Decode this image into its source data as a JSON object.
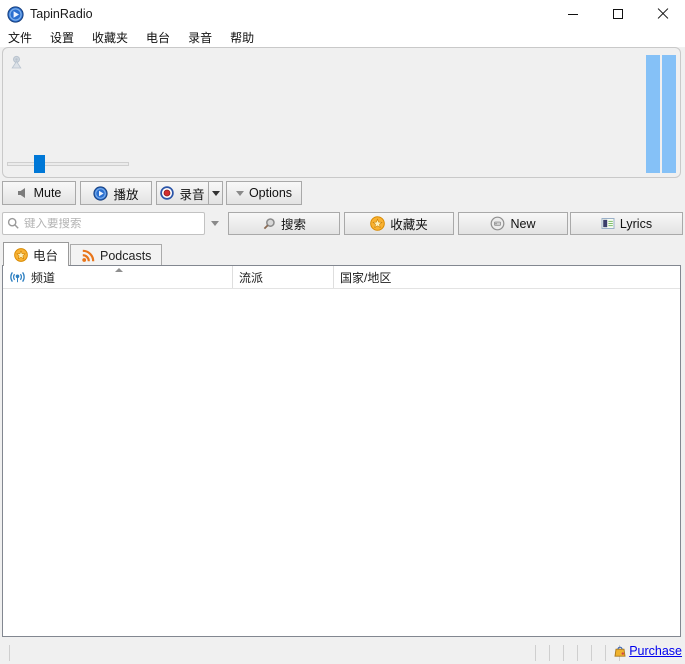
{
  "window": {
    "title": "TapinRadio"
  },
  "menu": {
    "items": [
      "文件",
      "设置",
      "收藏夹",
      "电台",
      "录音",
      "帮助"
    ]
  },
  "player": {
    "volume_percent": 22,
    "meter_count": 2
  },
  "toolbar": {
    "mute_label": "Mute",
    "play_label": "播放",
    "record_label": "录音",
    "options_label": "Options"
  },
  "search": {
    "placeholder": "键入要搜索",
    "search_label": "搜索",
    "favorites_label": "收藏夹",
    "new_label": "New",
    "lyrics_label": "Lyrics"
  },
  "tabs": [
    {
      "label": "电台",
      "active": true
    },
    {
      "label": "Podcasts",
      "active": false
    }
  ],
  "table": {
    "columns": [
      "频道",
      "流派",
      "国家/地区"
    ],
    "sort": {
      "column": "频道",
      "direction": "ascending"
    },
    "rows": []
  },
  "statusbar": {
    "purchase_label": "Purchase"
  },
  "colors": {
    "accent_blue": "#0078d7",
    "meter_blue": "#85c1f7",
    "link_blue": "#0000ee",
    "record_red": "#d32f2f",
    "badge_gold": "#f9b233",
    "rss_orange": "#e8751a"
  }
}
